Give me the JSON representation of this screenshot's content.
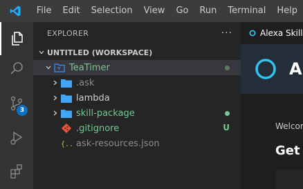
{
  "menu": [
    "File",
    "Edit",
    "Selection",
    "View",
    "Go",
    "Run",
    "Terminal",
    "Help"
  ],
  "activity": {
    "scm_badge": "3"
  },
  "explorer": {
    "title": "EXPLORER",
    "more": "···",
    "workspace_title": "UNTITLED (WORKSPACE)",
    "items": [
      {
        "label": "TeaTimer",
        "type": "root-folder",
        "expanded": true
      },
      {
        "label": ".ask",
        "type": "folder"
      },
      {
        "label": "lambda",
        "type": "folder"
      },
      {
        "label": "skill-package",
        "type": "folder"
      },
      {
        "label": ".gitignore",
        "type": "git-file",
        "decoration": "U"
      },
      {
        "label": "ask-resources.json",
        "type": "json-file"
      }
    ]
  },
  "editor": {
    "tab_label": "Alexa Skill",
    "banner_title": "Al",
    "welcome": "Welcor",
    "get_started": "Get s"
  },
  "colors": {
    "accent": "#0e70c0",
    "git_added": "#73c991",
    "root_folder": "#3794ff"
  }
}
